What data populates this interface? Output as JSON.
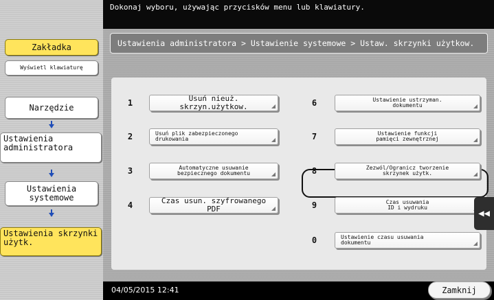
{
  "message": "Dokonaj wyboru, używając przycisków menu lub klawiatury.",
  "breadcrumb": "Ustawienia administratora  > Ustawienie systemowe > Ustaw. skrzynki użytkow.",
  "left_nav": {
    "bookmark": "Zakładka",
    "show_keyboard": "Wyświetl klawiaturę",
    "utility": "Narzędzie",
    "admin_settings": "Ustawienia administratora",
    "system_settings": "Ustawienia systemowe",
    "user_box_settings": "Ustawienia skrzynki użytk."
  },
  "menu": [
    {
      "num": "1",
      "label": "Usuń nieuż. skrzyn.użytkow."
    },
    {
      "num": "2",
      "label": "Usuń plik zabezpieczonego\ndrukowania"
    },
    {
      "num": "3",
      "label": "Automatyczne usuwanie\nbezpiecznego dokumentu"
    },
    {
      "num": "4",
      "label": "Czas usun. szyfrowanego PDF"
    },
    {
      "num": "6",
      "label": "Ustawienie ustrzyman.\ndokumentu"
    },
    {
      "num": "7",
      "label": "Ustawienie funkcji\npamięci zewnętrznej"
    },
    {
      "num": "8",
      "label": "Zezwól/Ogranicz tworzenie\nskrzynek użytk."
    },
    {
      "num": "9",
      "label": "Czas usuwania\nID i wydruku"
    },
    {
      "num": "0",
      "label": "Ustawienie czasu usuwania\ndokumentu"
    }
  ],
  "selected_item": "7",
  "status": {
    "datetime": "04/05/2015  12:41",
    "close_label": "Zamknij"
  },
  "side_tab_icon": "double-chevron-left-icon",
  "colors": {
    "highlight": "#ffe45c",
    "arrow": "#1f4db8",
    "top_bar": "#0a0a0a"
  }
}
